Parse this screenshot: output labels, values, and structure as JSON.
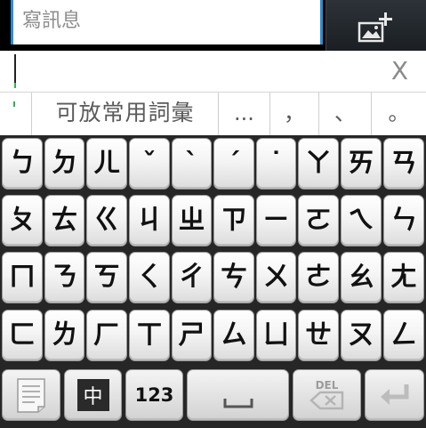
{
  "compose": {
    "placeholder": "寫訊息",
    "attach_icon": "image-add-icon"
  },
  "candidates": {
    "close_label": "X",
    "items": [
      "可放常用詞彙",
      "...",
      "，",
      "、",
      "。"
    ]
  },
  "keyboard": {
    "rows": [
      [
        "ㄅ",
        "ㄉ",
        "ㄦ",
        "ˇ",
        "ˋ",
        "ˊ",
        "˙",
        "ㄚ",
        "ㄞ",
        "ㄢ"
      ],
      [
        "ㄆ",
        "ㄊ",
        "ㄍ",
        "ㄐ",
        "ㄓ",
        "ㄗ",
        "ㄧ",
        "ㄛ",
        "ㄟ",
        "ㄣ"
      ],
      [
        "ㄇ",
        "ㄋ",
        "ㄎ",
        "ㄑ",
        "ㄔ",
        "ㄘ",
        "ㄨ",
        "ㄜ",
        "ㄠ",
        "ㄤ"
      ],
      [
        "ㄈ",
        "ㄌ",
        "ㄏ",
        "ㄒ",
        "ㄕ",
        "ㄙ",
        "ㄩ",
        "ㄝ",
        "ㄡ",
        "ㄥ"
      ]
    ],
    "function_row": {
      "settings_icon": "notepad-icon",
      "mode_label": "中",
      "numbers_label": "123",
      "space_icon": "space-bar-icon",
      "delete_label": "DEL",
      "delete_icon": "backspace-icon",
      "enter_icon": "enter-icon"
    }
  }
}
